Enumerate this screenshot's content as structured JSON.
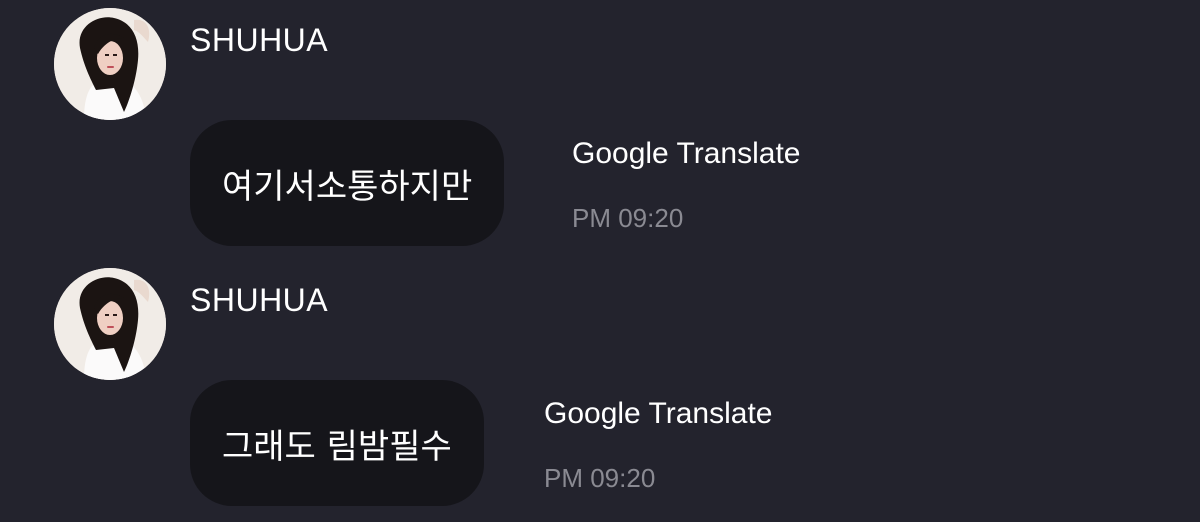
{
  "messages": [
    {
      "sender": "SHUHUA",
      "text": "여기서소통하지만",
      "translate_label": "Google Translate",
      "time": "PM 09:20"
    },
    {
      "sender": "SHUHUA",
      "text": "그래도 림밤필수",
      "translate_label": "Google Translate",
      "time": "PM 09:20"
    }
  ],
  "colors": {
    "background": "#23232d",
    "bubble": "#15151a",
    "text": "#ffffff",
    "timestamp": "#8a8a92"
  }
}
